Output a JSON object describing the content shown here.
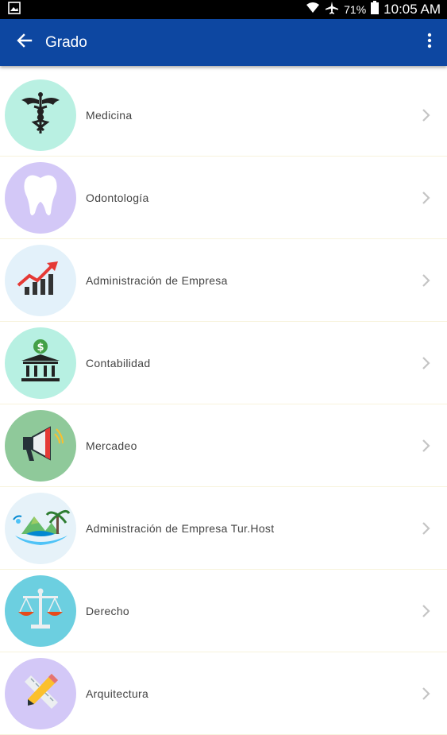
{
  "status_bar": {
    "battery_percent": "71%",
    "time": "10:05 AM",
    "icons": [
      "image-notification-icon",
      "wifi-icon",
      "airplane-icon",
      "battery-icon"
    ]
  },
  "app_bar": {
    "title": "Grado",
    "color": "#0d47a1",
    "icons": [
      "back-arrow-icon",
      "overflow-menu-icon"
    ]
  },
  "degrees": [
    {
      "label": "Medicina",
      "icon": "caduceus-icon",
      "bg": "#b9f0e2"
    },
    {
      "label": "Odontología",
      "icon": "tooth-icon",
      "bg": "#d3c8f7"
    },
    {
      "label": "Administración de Empresa",
      "icon": "growth-chart-icon",
      "bg": "#e3f1fa"
    },
    {
      "label": "Contabilidad",
      "icon": "bank-icon",
      "bg": "#b7f0e2"
    },
    {
      "label": "Mercadeo",
      "icon": "megaphone-icon",
      "bg": "#8fc99a"
    },
    {
      "label": "Administración de Empresa Tur.Host",
      "icon": "tropical-island-icon",
      "bg": "#e6f2f9"
    },
    {
      "label": "Derecho",
      "icon": "scales-of-justice-icon",
      "bg": "#6ccfe0"
    },
    {
      "label": "Arquitectura",
      "icon": "pencil-ruler-icon",
      "bg": "#d3c8f7"
    }
  ]
}
